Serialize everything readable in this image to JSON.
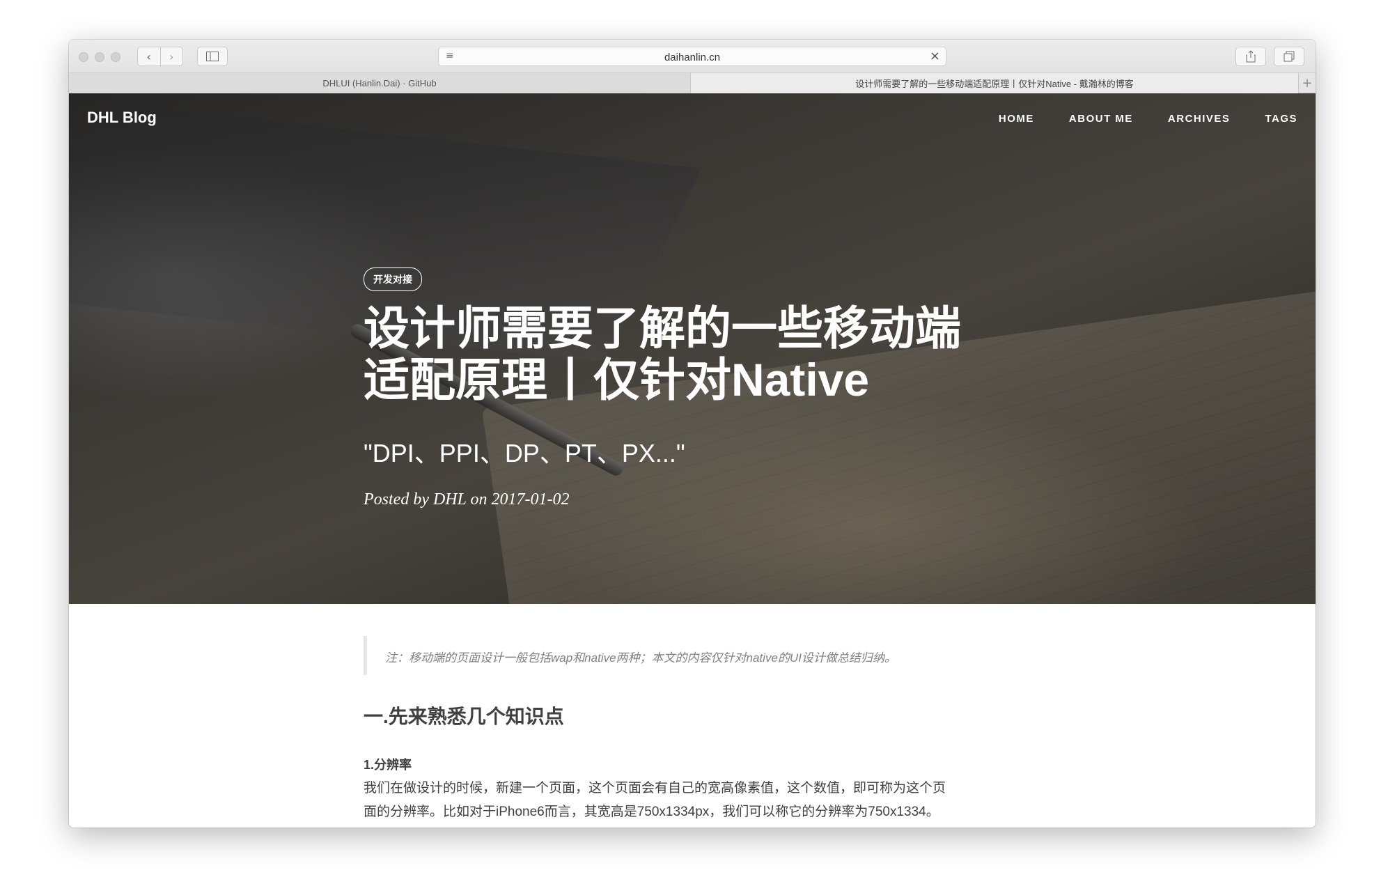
{
  "browser": {
    "url": "daihanlin.cn",
    "reader_icon": "reader-icon",
    "stop_icon": "close-icon",
    "tabs": [
      {
        "label": "DHLUI (Hanlin.Dai) · GitHub"
      },
      {
        "label": "设计师需要了解的一些移动端适配原理丨仅针对Native - 戴瀚林的博客"
      }
    ],
    "new_tab": "+"
  },
  "site": {
    "brand": "DHL Blog",
    "nav": [
      "HOME",
      "ABOUT ME",
      "ARCHIVES",
      "TAGS"
    ]
  },
  "hero": {
    "tag": "开发对接",
    "title_line1": "设计师需要了解的一些移动端",
    "title_line2": "适配原理丨仅针对Native",
    "subtitle": "\"DPI、PPI、DP、PT、PX...\"",
    "meta": "Posted by DHL on 2017-01-02"
  },
  "article": {
    "note": "注：移动端的页面设计一般包括wap和native两种；本文的内容仅针对native的UI设计做总结归纳。",
    "heading": "一.先来熟悉几个知识点",
    "subheading": "1.分辨率",
    "para_line1": "我们在做设计的时候，新建一个页面，这个页面会有自己的宽高像素值，这个数值，即可称为这个页",
    "para_line2": "面的分辨率。比如对于iPhone6而言，其宽高是750x1334px，我们可以称它的分辨率为750x1334。"
  }
}
